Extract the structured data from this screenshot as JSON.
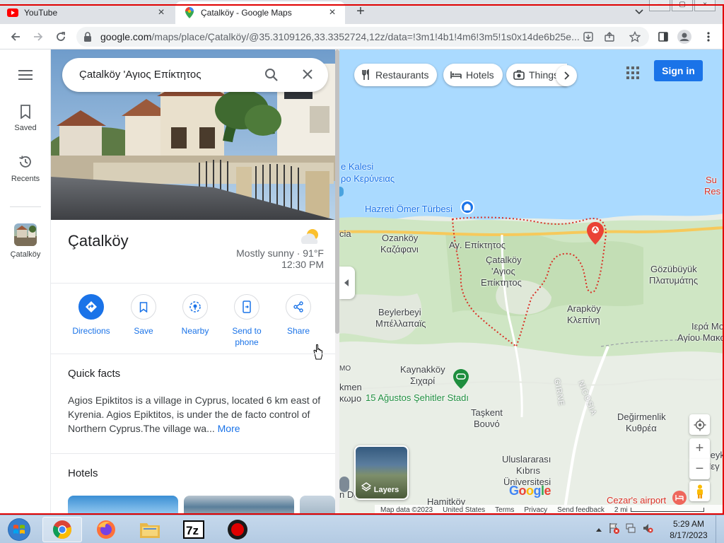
{
  "browser": {
    "tabs": [
      {
        "title": "YouTube",
        "icon": "youtube-icon"
      },
      {
        "title": "Çatalköy - Google Maps",
        "icon": "google-maps-icon"
      }
    ],
    "window_controls": [
      "minimize",
      "maximize",
      "close"
    ],
    "url_host": "google.com",
    "url_path": "/maps/place/Çatalköy/@35.3109126,33.3352724,12z/data=!3m1!4b1!4m6!3m5!1s0x14de6b25e..."
  },
  "rail": {
    "items": [
      {
        "label": "Saved",
        "icon": "bookmark-icon"
      },
      {
        "label": "Recents",
        "icon": "history-icon"
      },
      {
        "label": "Çatalköy",
        "icon": "place-thumbnail"
      }
    ]
  },
  "search": {
    "query": "Çatalköy 'Αγιος Επίκτητος"
  },
  "place": {
    "name": "Çatalköy",
    "weather": "Mostly sunny · 91°F",
    "time": "12:30 PM"
  },
  "actions": [
    {
      "label": "Directions",
      "icon": "directions-icon"
    },
    {
      "label": "Save",
      "icon": "bookmark-icon"
    },
    {
      "label": "Nearby",
      "icon": "nearby-icon"
    },
    {
      "label": "Send to phone",
      "icon": "send-to-phone-icon"
    },
    {
      "label": "Share",
      "icon": "share-icon"
    }
  ],
  "quick_facts": {
    "title": "Quick facts",
    "text": "Agios Epiktitos is a village in Cyprus, located 6 km east of Kyrenia. Agios Epiktitos, is under the de facto control of Northern Cyprus.The village wa... ",
    "more": "More"
  },
  "hotels": {
    "title": "Hotels"
  },
  "map": {
    "chips": [
      "Restaurants",
      "Hotels",
      "Things"
    ],
    "sign_in": "Sign in",
    "layers": "Layers",
    "labels": {
      "kalesi": "e Kalesi",
      "kerynia": "ρο Κερύνειας",
      "hazreti": "Hazreti Ömer Türbesi",
      "cia": "cia",
      "ozankoy": "Ozanköy",
      "kazafani": "Καζάφανι",
      "ag_epiktitos": "Αγ. Επίκτητος",
      "catalkoy_map": "Çatalköy",
      "agios": "'Αγιος",
      "epiktitos": "Επίκτητος",
      "gozubuyuk": "Gözübüyük",
      "platymatis": "Πλατυμάτης",
      "beylerbeyi": "Beylerbeyi",
      "bellapais": "Μπέλλαπαϊς",
      "arapkoy": "Arapköy",
      "klepini": "Κλεπίνη",
      "iera_moni": "Ιερά Μον",
      "agiou_makariou": "Αγίου Μακαρίο",
      "su": "Su",
      "res": "Res",
      "omo": "ΜΟ",
      "kaynakkoy": "Kaynakköy",
      "sichari": "Σιχαρί",
      "kmen": "kmen",
      "komo": "κωμο",
      "agustos": "15 Ağustos Şehitler Stadı",
      "girne": "GIRNE",
      "nicosia": "NICOSIA",
      "taskent": "Taşkent",
      "vouno": "Βουνό",
      "degirmenlik": "Değirmenlik",
      "kythrea": "Κυθρέα",
      "uluslararasi": "Uluslararası",
      "kibris": "Kıbrıs",
      "universitesi": "Üniversitesi",
      "n_dogu": "n Doğu",
      "hamitkoy": "Hamitköy",
      "cezar": "Cezar's airport",
      "beyk": "Beyk",
      "pey": "Πεγ"
    },
    "attribution": [
      "Map data ©2023",
      "United States",
      "Terms",
      "Privacy",
      "Send feedback",
      "2 mi"
    ],
    "logo": "Google"
  },
  "taskbar": {
    "apps": [
      "chrome-icon",
      "firefox-icon",
      "file-explorer-icon",
      "7zip-icon",
      "record-icon"
    ],
    "time": "5:29 AM",
    "date": "8/17/2023"
  },
  "colors": {
    "accent": "#1a73e8",
    "boundary": "#d93025",
    "land_green": "#cfe6c4",
    "sea": "#aadaff"
  }
}
